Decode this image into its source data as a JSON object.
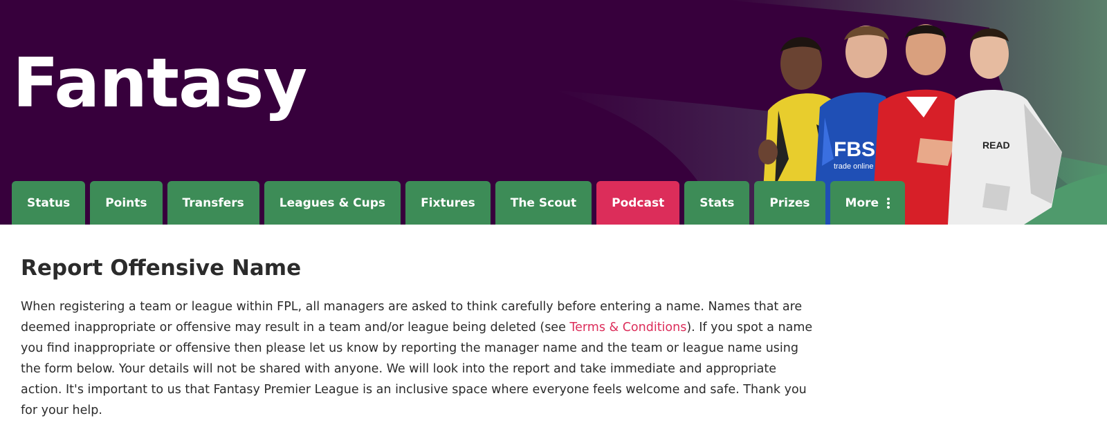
{
  "header": {
    "title": "Fantasy"
  },
  "nav": {
    "tabs": [
      {
        "label": "Status"
      },
      {
        "label": "Points"
      },
      {
        "label": "Transfers"
      },
      {
        "label": "Leagues & Cups"
      },
      {
        "label": "Fixtures"
      },
      {
        "label": "The Scout"
      },
      {
        "label": "Podcast"
      },
      {
        "label": "Stats"
      },
      {
        "label": "Prizes"
      },
      {
        "label": "More"
      }
    ],
    "more_icon": "kebab-menu-icon"
  },
  "main": {
    "heading": "Report Offensive Name",
    "intro_before_link": "When registering a team or league within FPL, all managers are asked to think carefully before entering a name. Names that are deemed inappropriate or offensive may result in a team and/or league being deleted (see ",
    "terms_link": "Terms & Conditions",
    "intro_after_link": "). If you spot a name you find inappropriate or offensive then please let us know by reporting the manager name and the team or league name using the form below. Your details will not be shared with anyone. We will look into the report and take immediate and appropriate action. It's important to us that Fantasy Premier League is an inclusive space where everyone feels welcome and safe. Thank you for your help."
  },
  "hero_image": {
    "shirt_texts": [
      "FBS",
      "trade online",
      "READ"
    ]
  },
  "colors": {
    "header_bg": "#37003c",
    "tab_green": "#3d8c57",
    "tab_podcast": "#dc2d5a",
    "link": "#dc2d5a",
    "text": "#2b2b2b"
  }
}
